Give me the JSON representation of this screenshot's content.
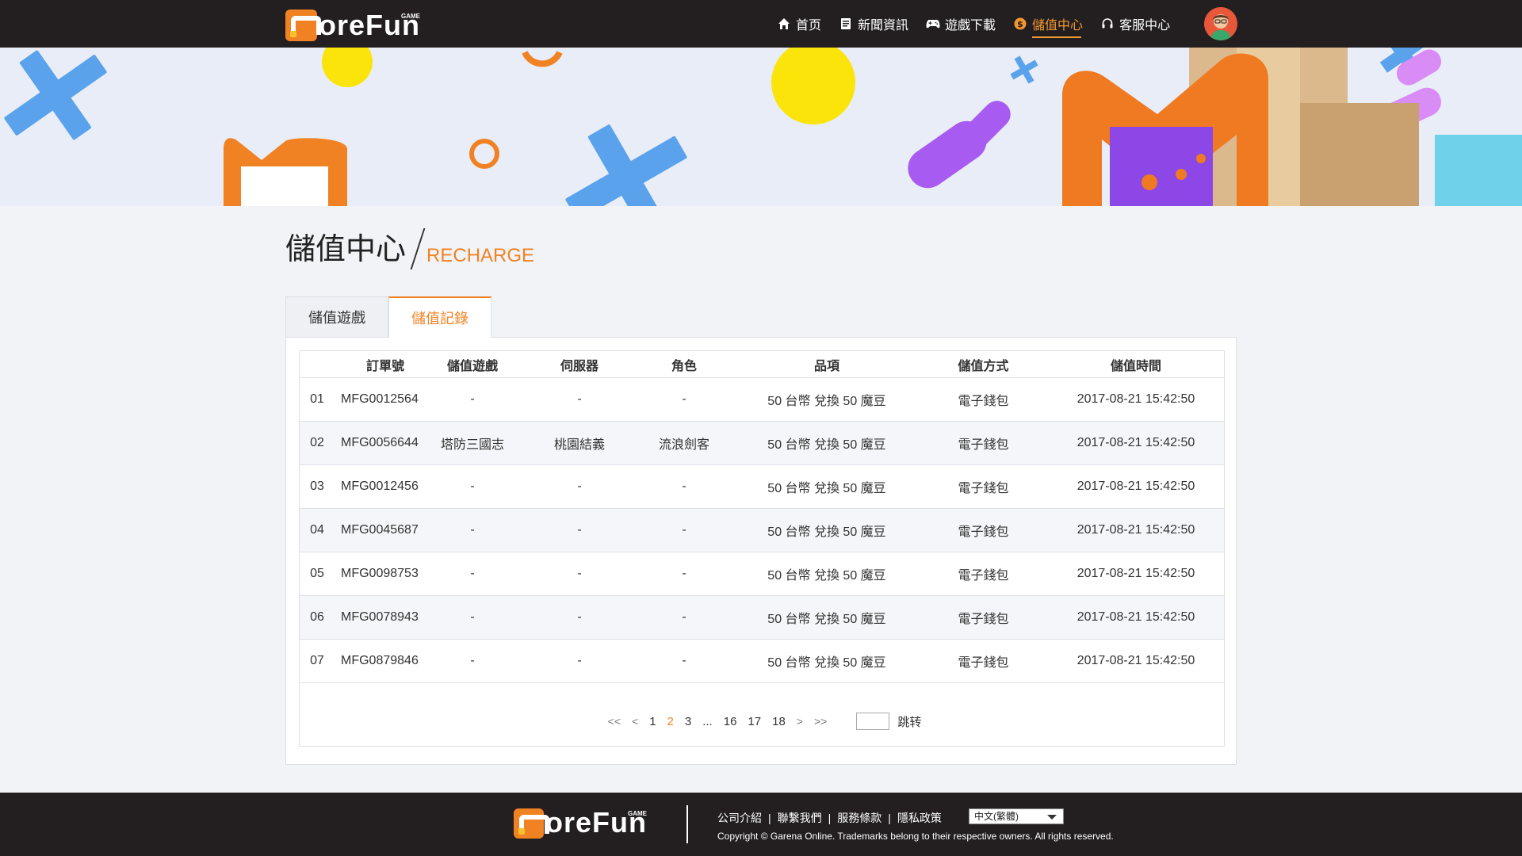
{
  "brand": {
    "name": "oreFun",
    "tag": "GAME"
  },
  "nav": {
    "items": [
      {
        "label": "首页",
        "icon": "home-icon",
        "active": false
      },
      {
        "label": "新聞資訊",
        "icon": "news-icon",
        "active": false
      },
      {
        "label": "遊戲下載",
        "icon": "gamepad-icon",
        "active": false
      },
      {
        "label": "儲值中心",
        "icon": "coin-icon",
        "active": true
      },
      {
        "label": "客服中心",
        "icon": "headset-icon",
        "active": false
      }
    ]
  },
  "page": {
    "title_zh": "儲值中心",
    "title_en": "RECHARGE"
  },
  "tabs": [
    {
      "label": "儲值遊戲",
      "active": false
    },
    {
      "label": "儲值記錄",
      "active": true
    }
  ],
  "table": {
    "headers": [
      "訂單號",
      "儲值遊戲",
      "伺服器",
      "角色",
      "品項",
      "儲值方式",
      "儲值時間"
    ],
    "rows": [
      {
        "idx": "01",
        "order": "MFG0012564",
        "game": "-",
        "server": "-",
        "role": "-",
        "item": "50 台幣  兌換  50 魔豆",
        "method": "電子錢包",
        "time": "2017-08-21 15:42:50"
      },
      {
        "idx": "02",
        "order": "MFG0056644",
        "game": "塔防三國志",
        "server": "桃園結義",
        "role": "流浪劍客",
        "item": "50 台幣  兌換  50 魔豆",
        "method": "電子錢包",
        "time": "2017-08-21 15:42:50"
      },
      {
        "idx": "03",
        "order": "MFG0012456",
        "game": "-",
        "server": "-",
        "role": "-",
        "item": "50 台幣  兌換  50 魔豆",
        "method": "電子錢包",
        "time": "2017-08-21 15:42:50"
      },
      {
        "idx": "04",
        "order": "MFG0045687",
        "game": "-",
        "server": "-",
        "role": "-",
        "item": "50 台幣  兌換  50 魔豆",
        "method": "電子錢包",
        "time": "2017-08-21 15:42:50"
      },
      {
        "idx": "05",
        "order": "MFG0098753",
        "game": "-",
        "server": "-",
        "role": "-",
        "item": "50 台幣  兌換  50 魔豆",
        "method": "電子錢包",
        "time": "2017-08-21 15:42:50"
      },
      {
        "idx": "06",
        "order": "MFG0078943",
        "game": "-",
        "server": "-",
        "role": "-",
        "item": "50 台幣  兌換  50 魔豆",
        "method": "電子錢包",
        "time": "2017-08-21 15:42:50"
      },
      {
        "idx": "07",
        "order": "MFG0879846",
        "game": "-",
        "server": "-",
        "role": "-",
        "item": "50 台幣  兌換  50 魔豆",
        "method": "電子錢包",
        "time": "2017-08-21 15:42:50"
      }
    ]
  },
  "pagination": {
    "first": "<<",
    "prev": "<",
    "next": ">",
    "last": ">>",
    "pages": [
      "1",
      "2",
      "3",
      "...",
      "16",
      "17",
      "18"
    ],
    "current": "2",
    "jump_label": "跳转",
    "jump_value": ""
  },
  "footer": {
    "links": [
      "公司介紹",
      "聯繫我們",
      "服務條款",
      "隱私政策"
    ],
    "language": "中文(繁體)",
    "copyright": "Copyright © Garena Online. Trademarks belong to their respective owners. All rights reserved."
  },
  "colors": {
    "accent": "#f08224",
    "header_bg": "#231f20",
    "page_bg": "#f2f3f7"
  }
}
